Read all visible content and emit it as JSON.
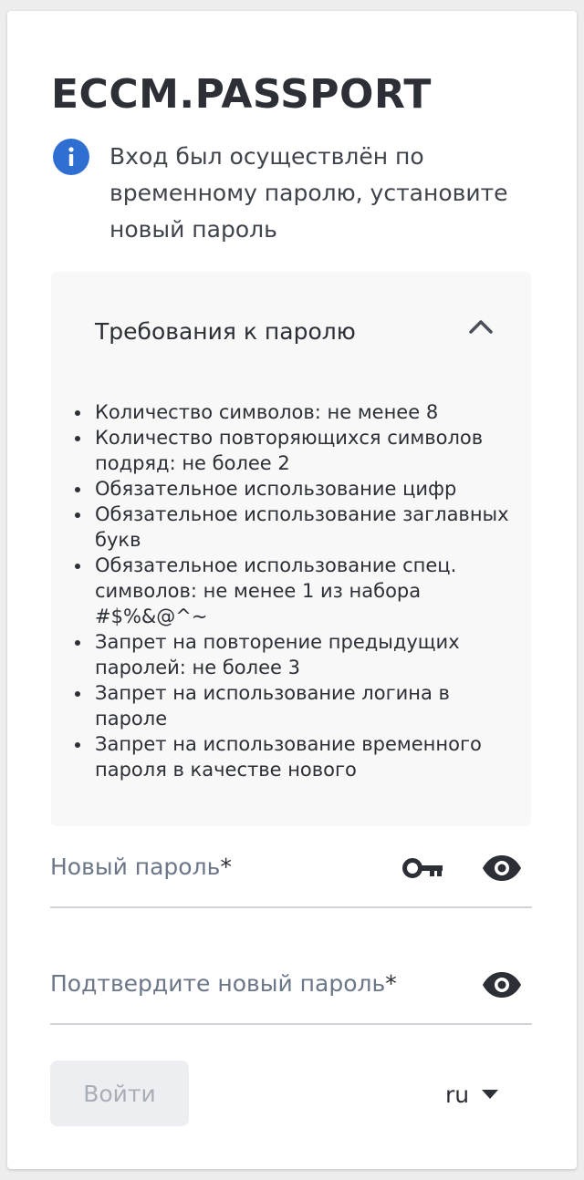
{
  "app_title": "ECCM.PASSPORT",
  "notice": {
    "icon": "info-icon",
    "text": "Вход был осуществлён по временному паролю, установите новый пароль"
  },
  "requirements": {
    "title": "Требования к паролю",
    "expanded": true,
    "items": [
      "Количество символов: не менее 8",
      "Количество повторяющихся символов подряд: не более 2",
      "Обязательное использование цифр",
      "Обязательное использование заглавных букв",
      "Обязательное использование спец. символов: не менее 1 из набора #$%&@^~",
      "Запрет на повторение предыдущих паролей: не более 3",
      "Запрет на использование логина в пароле",
      "Запрет на использование временного пароля в качестве нового"
    ]
  },
  "form": {
    "new_password": {
      "label": "Новый пароль",
      "required_mark": "*",
      "value": ""
    },
    "confirm_password": {
      "label": "Подтвердите новый пароль",
      "required_mark": "*",
      "value": ""
    },
    "submit_label": "Войти",
    "language": "ru"
  },
  "colors": {
    "accent": "#2f6fd1",
    "text": "#2c2f36",
    "muted_label": "#6b7689",
    "panel_bg": "#f8f8f9",
    "disabled_button_bg": "#eceef1",
    "disabled_button_text": "#a8adb6"
  }
}
